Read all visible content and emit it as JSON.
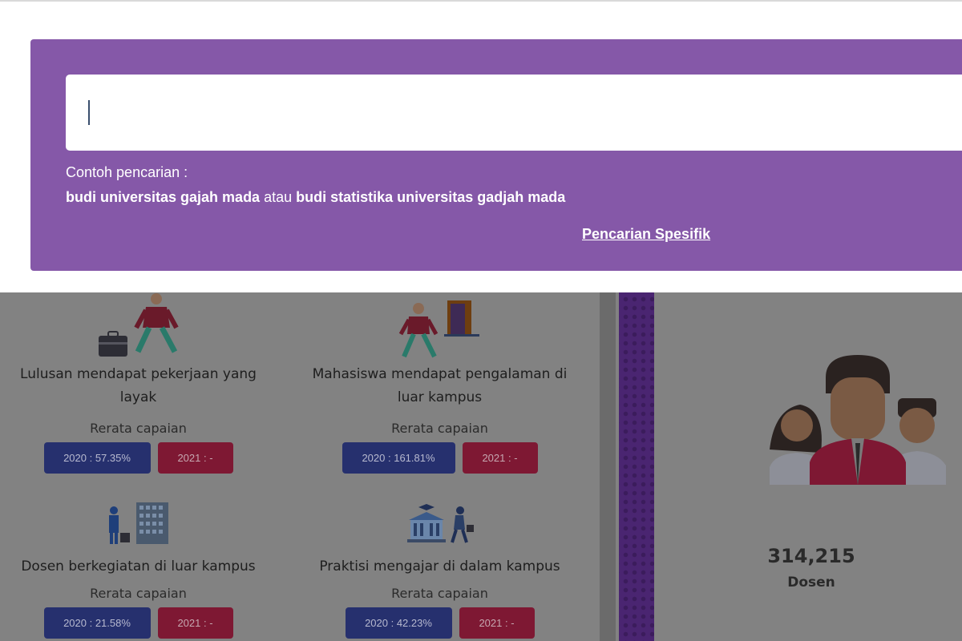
{
  "search": {
    "placeholder": "",
    "value": "",
    "hint_label": "Contoh pencarian :",
    "example_1": "budi universitas gajah mada",
    "connector": "atau",
    "example_2": "budi statistika universitas gadjah mada",
    "specific_link": "Pencarian Spesifik"
  },
  "cards": [
    {
      "title": "Lulusan mendapat pekerjaan yang layak",
      "subtitle": "Rerata capaian",
      "pill_2020": "2020 : 57.35%",
      "pill_2021": "2021 : -",
      "icon": "job-seeker-icon"
    },
    {
      "title": "Mahasiswa mendapat pengalaman di luar kampus",
      "subtitle": "Rerata capaian",
      "pill_2020": "2020 : 161.81%",
      "pill_2021": "2021 : -",
      "icon": "student-door-icon"
    },
    {
      "title": "Dosen berkegiatan di luar kampus",
      "subtitle": "Rerata capaian",
      "pill_2020": "2020 : 21.58%",
      "pill_2021": "2021 : -",
      "icon": "lecturer-building-icon"
    },
    {
      "title": "Praktisi mengajar di dalam kampus",
      "subtitle": "Rerata capaian",
      "pill_2020": "2020 : 42.23%",
      "pill_2021": "2021 : -",
      "icon": "campus-practitioner-icon"
    }
  ],
  "stat": {
    "value": "314,215",
    "label": "Dosen",
    "icon": "people-group-icon"
  },
  "colors": {
    "panel_purple": "#8558a8",
    "pill_blue": "#26306e",
    "pill_red": "#7e1833",
    "dim_background": "#828282"
  }
}
